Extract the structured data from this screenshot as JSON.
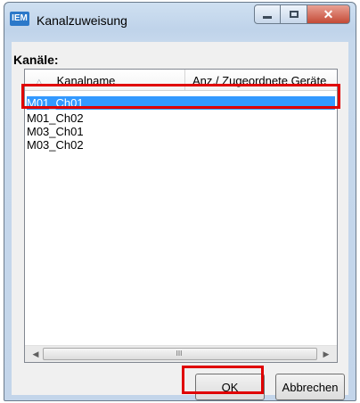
{
  "window": {
    "title": "Kanalzuweisung",
    "app_icon_text": "IEM",
    "buttons": {
      "minimize": "minimize-icon",
      "maximize": "maximize-icon",
      "close": "close-icon"
    }
  },
  "section": {
    "label": "Kanäle:"
  },
  "listview": {
    "columns": [
      "Kanalname",
      "Anz./ Zugeordnete Geräte"
    ],
    "rows": [
      {
        "name": "M01_Ch01",
        "selected": true
      },
      {
        "name": "M01_Ch02",
        "selected": false
      },
      {
        "name": "M03_Ch01",
        "selected": false
      },
      {
        "name": "M03_Ch02",
        "selected": false
      }
    ],
    "scrollbar_grip": "III"
  },
  "actions": {
    "ok": "OK",
    "cancel": "Abbrechen"
  },
  "colors": {
    "selection": "#3399ff",
    "highlight_box": "#e00000"
  }
}
